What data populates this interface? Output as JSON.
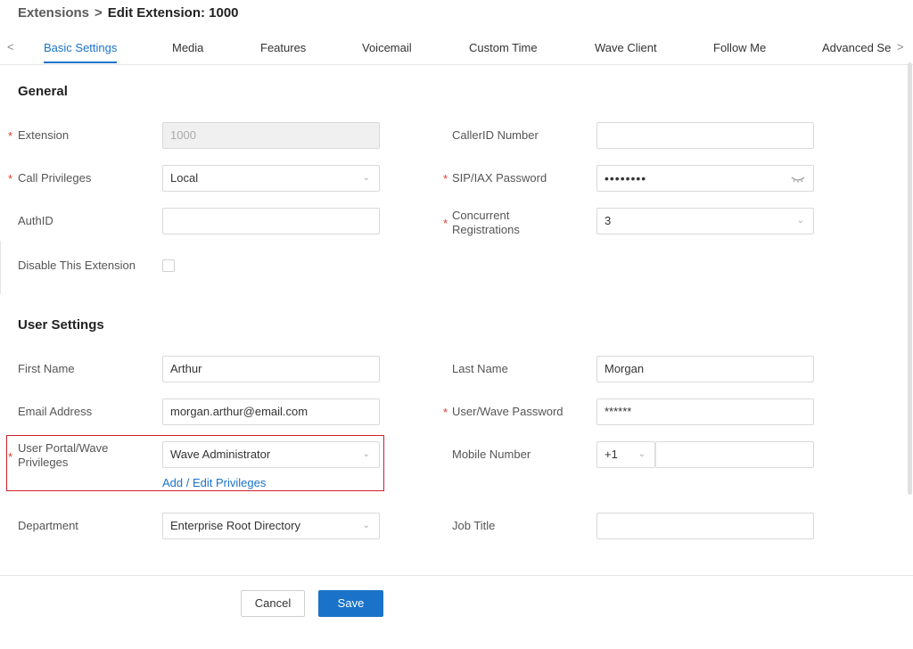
{
  "breadcrumb": {
    "parent": "Extensions",
    "separator": ">",
    "current": "Edit Extension: 1000"
  },
  "tabs": [
    {
      "label": "Basic Settings",
      "active": true
    },
    {
      "label": "Media"
    },
    {
      "label": "Features"
    },
    {
      "label": "Voicemail"
    },
    {
      "label": "Custom Time"
    },
    {
      "label": "Wave Client"
    },
    {
      "label": "Follow Me"
    },
    {
      "label": "Advanced Se"
    }
  ],
  "nav": {
    "prev_icon": "chevron-left-icon",
    "next_icon": "chevron-right-icon",
    "prev_glyph": "<",
    "next_glyph": ">"
  },
  "general": {
    "title": "General",
    "extension": {
      "label": "Extension",
      "value": "1000"
    },
    "call_privileges": {
      "label": "Call Privileges",
      "value": "Local"
    },
    "auth_id": {
      "label": "AuthID",
      "value": ""
    },
    "disable_extension": {
      "label": "Disable This Extension",
      "checked": false
    },
    "callerid_number": {
      "label": "CallerID Number",
      "value": ""
    },
    "sip_iax_password": {
      "label": "SIP/IAX Password",
      "masked": "••••••••"
    },
    "concurrent_registrations": {
      "label": "Concurrent Registrations",
      "label_line1": "Concurrent",
      "label_line2": "Registrations",
      "value": "3"
    }
  },
  "user_settings": {
    "title": "User Settings",
    "first_name": {
      "label": "First Name",
      "value": "Arthur"
    },
    "last_name": {
      "label": "Last Name",
      "value": "Morgan"
    },
    "email": {
      "label": "Email Address",
      "value": "morgan.arthur@email.com"
    },
    "user_wave_password": {
      "label": "User/Wave Password",
      "masked": "******"
    },
    "portal_privileges": {
      "label_line1": "User Portal/Wave",
      "label_line2": "Privileges",
      "value": "Wave Administrator",
      "link": "Add / Edit Privileges"
    },
    "mobile_number": {
      "label": "Mobile Number",
      "prefix": "+1",
      "value": ""
    },
    "department": {
      "label": "Department",
      "value": "Enterprise Root Directory"
    },
    "job_title": {
      "label": "Job Title",
      "value": ""
    }
  },
  "required_marker": "*",
  "actions": {
    "cancel": "Cancel",
    "save": "Save"
  },
  "colors": {
    "accent": "#1a73c8",
    "required": "#e2382b",
    "highlight": "#d0202a"
  }
}
